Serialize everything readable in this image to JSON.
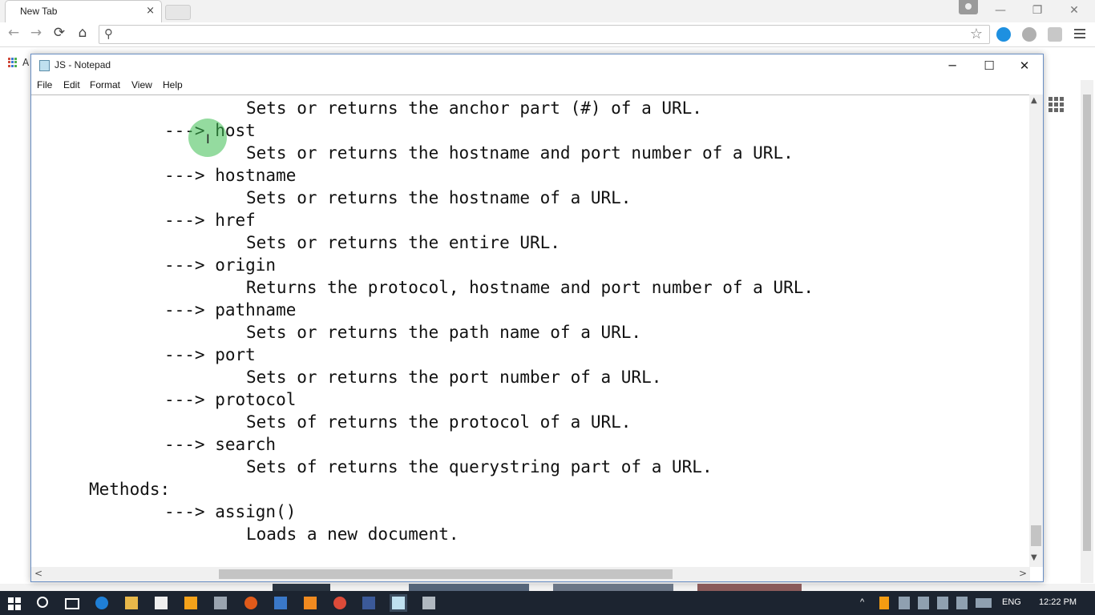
{
  "browser": {
    "tab_title": "New Tab",
    "tab_close": "×",
    "window_controls": {
      "minimize": "—",
      "restore": "❐",
      "close": "✕"
    },
    "nav": {
      "back": "←",
      "forward": "→",
      "reload": "⟳",
      "home": "⌂"
    },
    "omnibox_placeholder": "",
    "apps_label": "A"
  },
  "notepad": {
    "title": "JS - Notepad",
    "controls": {
      "minimize": "─",
      "maximize": "☐",
      "close": "✕"
    },
    "menu": [
      "File",
      "Edit",
      "Format",
      "View",
      "Help"
    ],
    "lines": [
      {
        "indent": 2,
        "text": "Sets or returns the anchor part (#) of a URL."
      },
      {
        "indent": 1,
        "text": "---> host"
      },
      {
        "indent": 2,
        "text": "Sets or returns the hostname and port number of a URL."
      },
      {
        "indent": 1,
        "text": "---> hostname"
      },
      {
        "indent": 2,
        "text": "Sets or returns the hostname of a URL."
      },
      {
        "indent": 1,
        "text": "---> href"
      },
      {
        "indent": 2,
        "text": "Sets or returns the entire URL."
      },
      {
        "indent": 1,
        "text": "---> origin"
      },
      {
        "indent": 2,
        "text": "Returns the protocol, hostname and port number of a URL."
      },
      {
        "indent": 1,
        "text": "---> pathname"
      },
      {
        "indent": 2,
        "text": "Sets or returns the path name of a URL."
      },
      {
        "indent": 1,
        "text": "---> port"
      },
      {
        "indent": 2,
        "text": "Sets or returns the port number of a URL."
      },
      {
        "indent": 1,
        "text": "---> protocol"
      },
      {
        "indent": 2,
        "text": "Sets of returns the protocol of a URL."
      },
      {
        "indent": 1,
        "text": "---> search"
      },
      {
        "indent": 2,
        "text": "Sets of returns the querystring part of a URL."
      },
      {
        "indent": 0,
        "text": "Methods:"
      },
      {
        "indent": 1,
        "text": "---> assign()"
      },
      {
        "indent": 2,
        "text": "Loads a new document."
      }
    ]
  },
  "taskbar": {
    "language": "ENG",
    "time": "12:22 PM"
  },
  "colors": {
    "taskbar": "#1c2430",
    "notepad_border": "#6a8fc4",
    "cursor_halo": "#3cbe50"
  }
}
